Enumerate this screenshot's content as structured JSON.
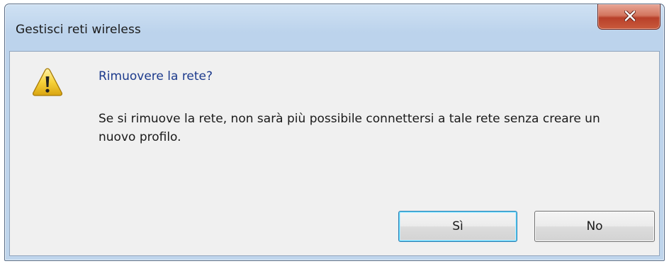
{
  "window": {
    "title": "Gestisci reti wireless",
    "close_icon": "close-icon"
  },
  "dialog": {
    "icon": "warning-icon",
    "heading": "Rimuovere la rete?",
    "message": "Se si rimuove la rete, non sarà più possibile connettersi a tale rete senza creare un nuovo profilo."
  },
  "buttons": {
    "yes_label": "Sì",
    "no_label": "No"
  },
  "colors": {
    "heading": "#1c3a8c",
    "close_button": "#c95a3c",
    "frame": "#bfd5ec",
    "content_bg": "#f0f0f0"
  }
}
